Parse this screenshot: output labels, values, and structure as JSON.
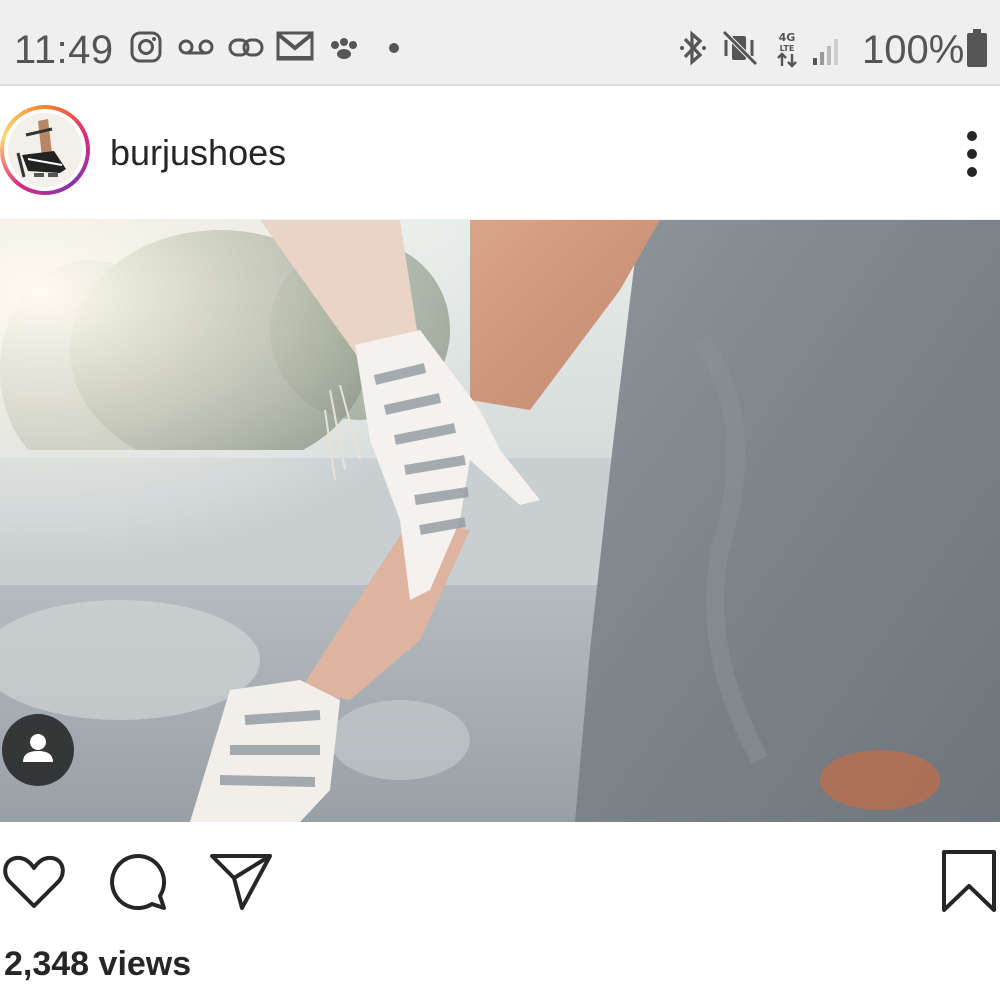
{
  "status_bar": {
    "time": "11:49",
    "battery": "100%",
    "left_icons": [
      "instagram-icon",
      "voicemail-icon",
      "link-icon",
      "gmail-icon",
      "paw-icon",
      "dot-icon"
    ],
    "right_icons": [
      "bluetooth-icon",
      "vibrate-mute-icon",
      "4g-lte-icon",
      "signal-icon",
      "battery-icon"
    ]
  },
  "post": {
    "username": "burjushoes",
    "views": "2,348 views"
  },
  "actions": [
    "heart-icon",
    "comment-icon",
    "share-icon",
    "bookmark-icon"
  ],
  "colors": {
    "text": "#262626",
    "status_bar_bg": "#efefef",
    "story_ring": [
      "#f58529",
      "#dd2a7b",
      "#8134af",
      "#feda77"
    ]
  }
}
